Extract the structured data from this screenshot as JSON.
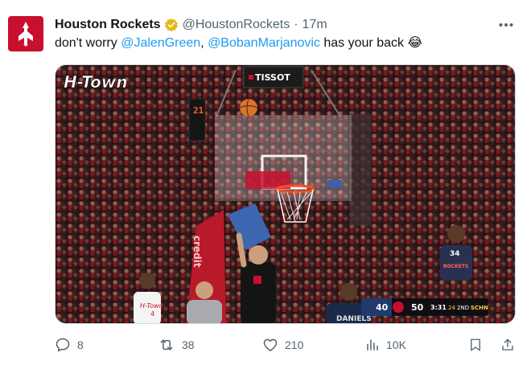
{
  "tweet": {
    "display_name": "Houston Rockets",
    "handle": "@HoustonRockets",
    "separator": "·",
    "time": "17m",
    "text_prefix": "don't worry ",
    "mention_1": "@JalenGreen",
    "text_middle": ", ",
    "mention_2": "@BobanMarjanovic",
    "text_suffix": " has your back ",
    "emoji": "😂"
  },
  "media": {
    "logo_text": "H-Town",
    "sponsor": "TISSOT",
    "shot_clock": "21",
    "stanchion_text": "credit",
    "scoreboard": {
      "away_score": "40",
      "home_score": "50",
      "clock": "3:31",
      "shot_clock": "24",
      "period": "2ND",
      "network": "SCHN"
    },
    "player_jersey": "34",
    "back_name": "DANIELS",
    "fan_jersey": "ROCKETS",
    "front_jersey": "4"
  },
  "actions": {
    "replies": "8",
    "retweets": "38",
    "likes": "210",
    "views": "10K"
  },
  "colors": {
    "brand_red": "#c8102e",
    "link_blue": "#1d9bf0",
    "secondary_text": "#536471",
    "verified_gold": "#e2b719"
  }
}
